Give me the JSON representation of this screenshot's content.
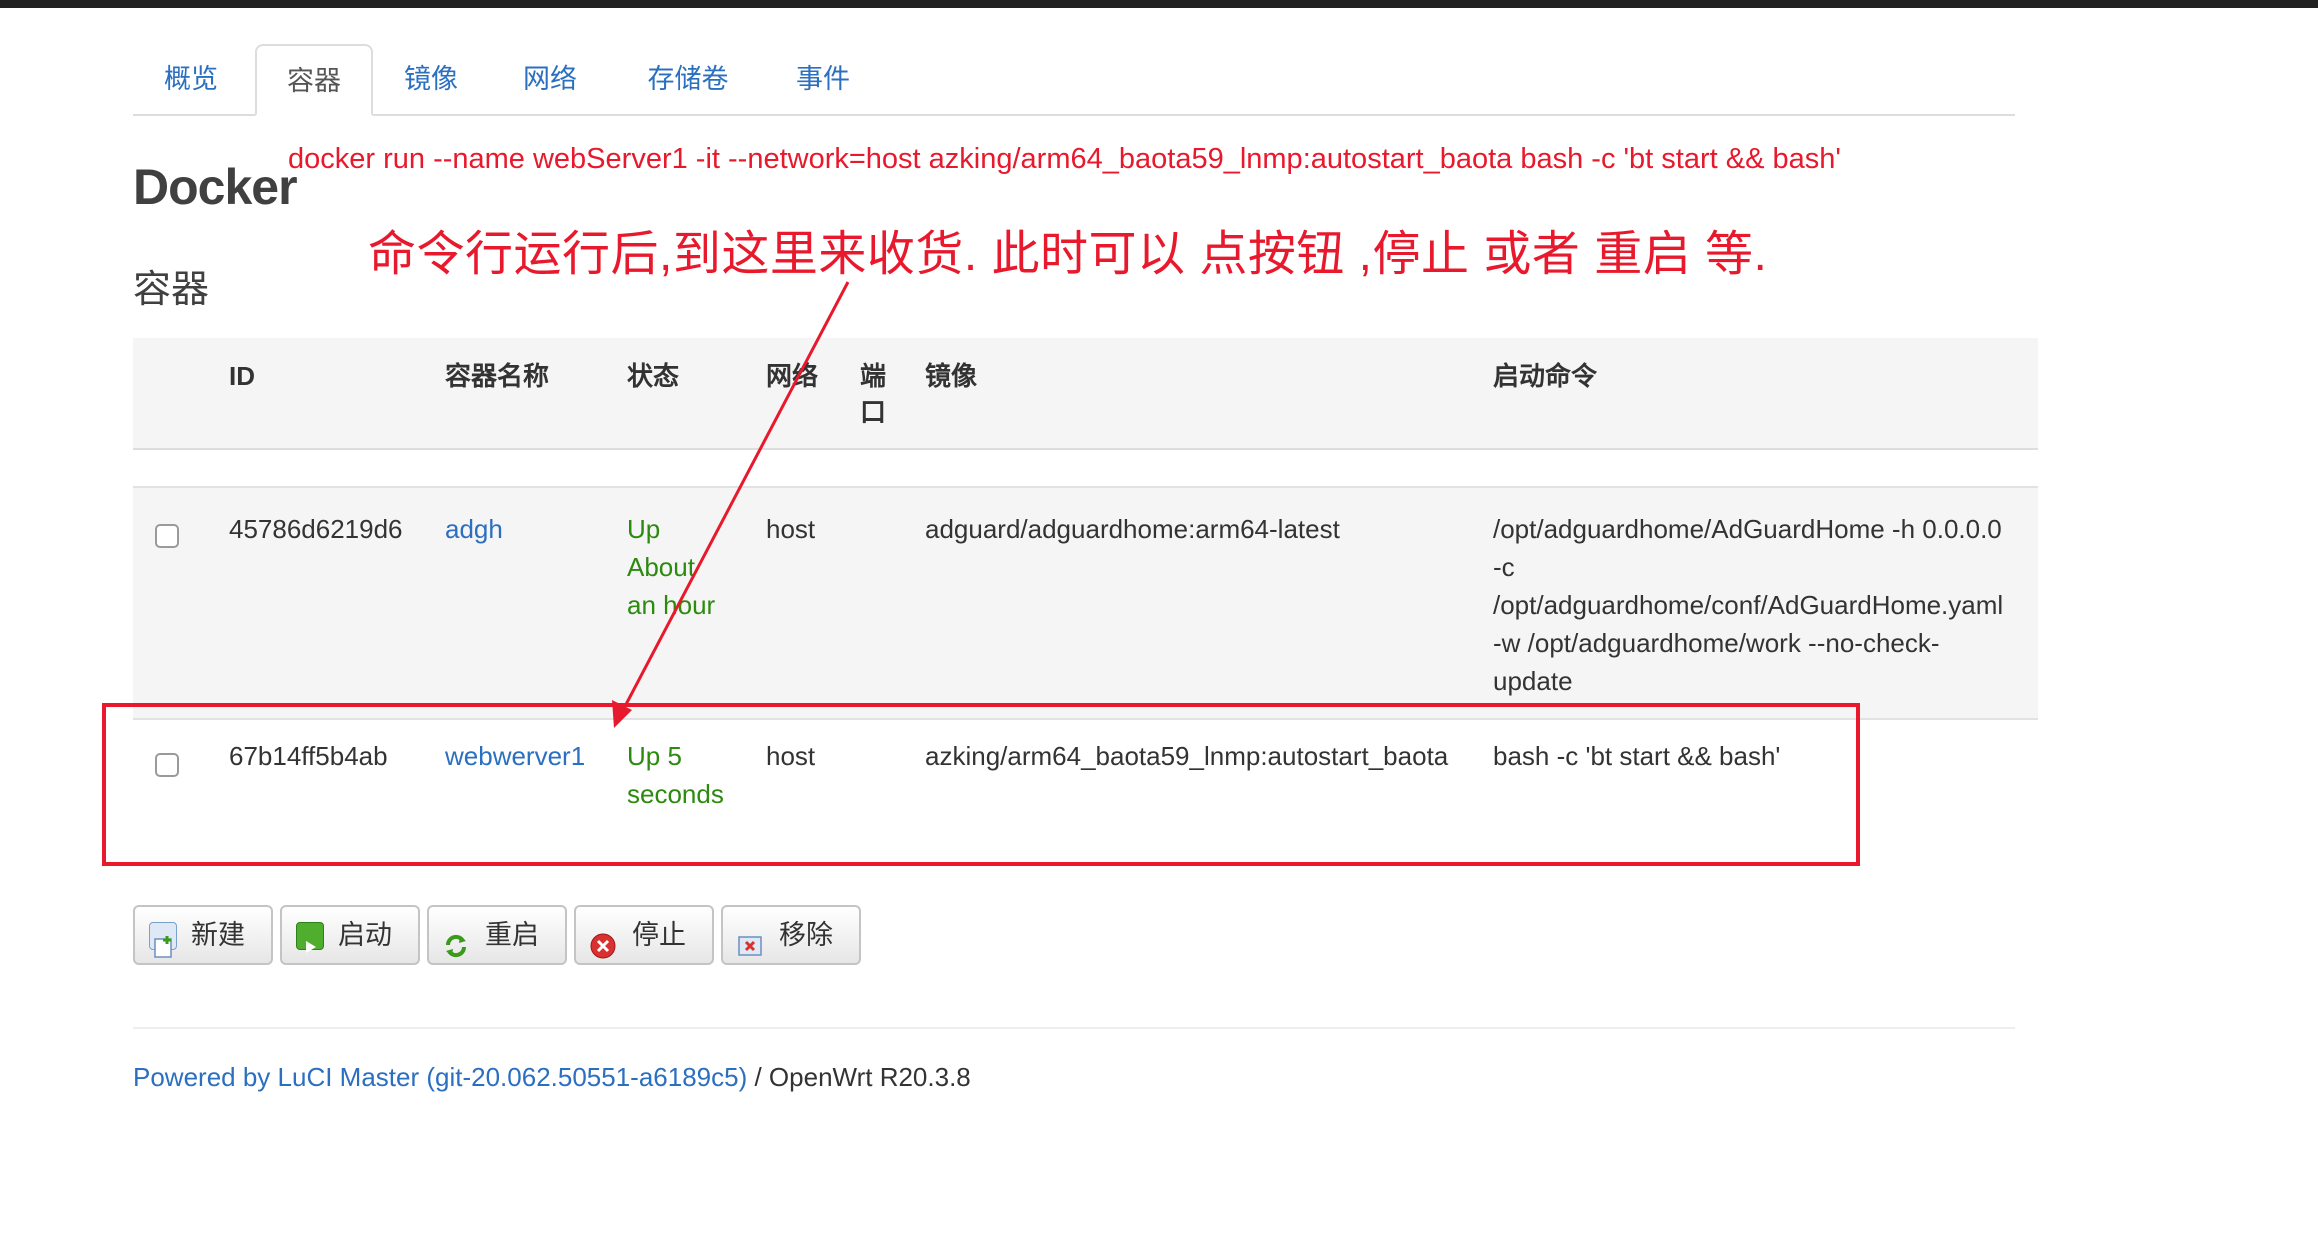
{
  "tabs": [
    {
      "label": "概览",
      "active": false
    },
    {
      "label": "容器",
      "active": true
    },
    {
      "label": "镜像",
      "active": false
    },
    {
      "label": "网络",
      "active": false
    },
    {
      "label": "存储卷",
      "active": false
    },
    {
      "label": "事件",
      "active": false
    }
  ],
  "page_title": "Docker",
  "section_title": "容器",
  "annotations": {
    "command": "docker run  --name webServer1  -it  --network=host   azking/arm64_baota59_lnmp:autostart_baota   bash -c  'bt start && bash'",
    "note": "命令行运行后,到这里来收货. 此时可以 点按钮 ,停止 或者 重启 等.",
    "color": "#e8192c"
  },
  "table": {
    "headers": {
      "id": "ID",
      "name": "容器名称",
      "status": "状态",
      "network": "网络",
      "port_line1": "端",
      "port_line2": "口",
      "image": "镜像",
      "command": "启动命令"
    },
    "rows": [
      {
        "id": "45786d6219d6",
        "name": "adgh",
        "status": [
          "Up",
          "About",
          "an hour"
        ],
        "network": "host",
        "port": "",
        "image": "adguard/adguardhome:arm64-latest",
        "command": [
          "/opt/adguardhome/AdGuardHome -h 0.0.0.0",
          "-c",
          "/opt/adguardhome/conf/AdGuardHome.yaml",
          "-w /opt/adguardhome/work --no-check-",
          "update"
        ]
      },
      {
        "id": "67b14ff5b4ab",
        "name": "webwerver1",
        "status": [
          "Up 5",
          "seconds"
        ],
        "network": "host",
        "port": "",
        "image": "azking/arm64_baota59_lnmp:autostart_baota",
        "command": [
          "bash -c 'bt start && bash'"
        ]
      }
    ]
  },
  "buttons": {
    "new": "新建",
    "start": "启动",
    "restart": "重启",
    "stop": "停止",
    "remove": "移除"
  },
  "footer": {
    "link": "Powered by LuCI Master (git-20.062.50551-a6189c5)",
    "text": " / OpenWrt R20.3.8"
  }
}
